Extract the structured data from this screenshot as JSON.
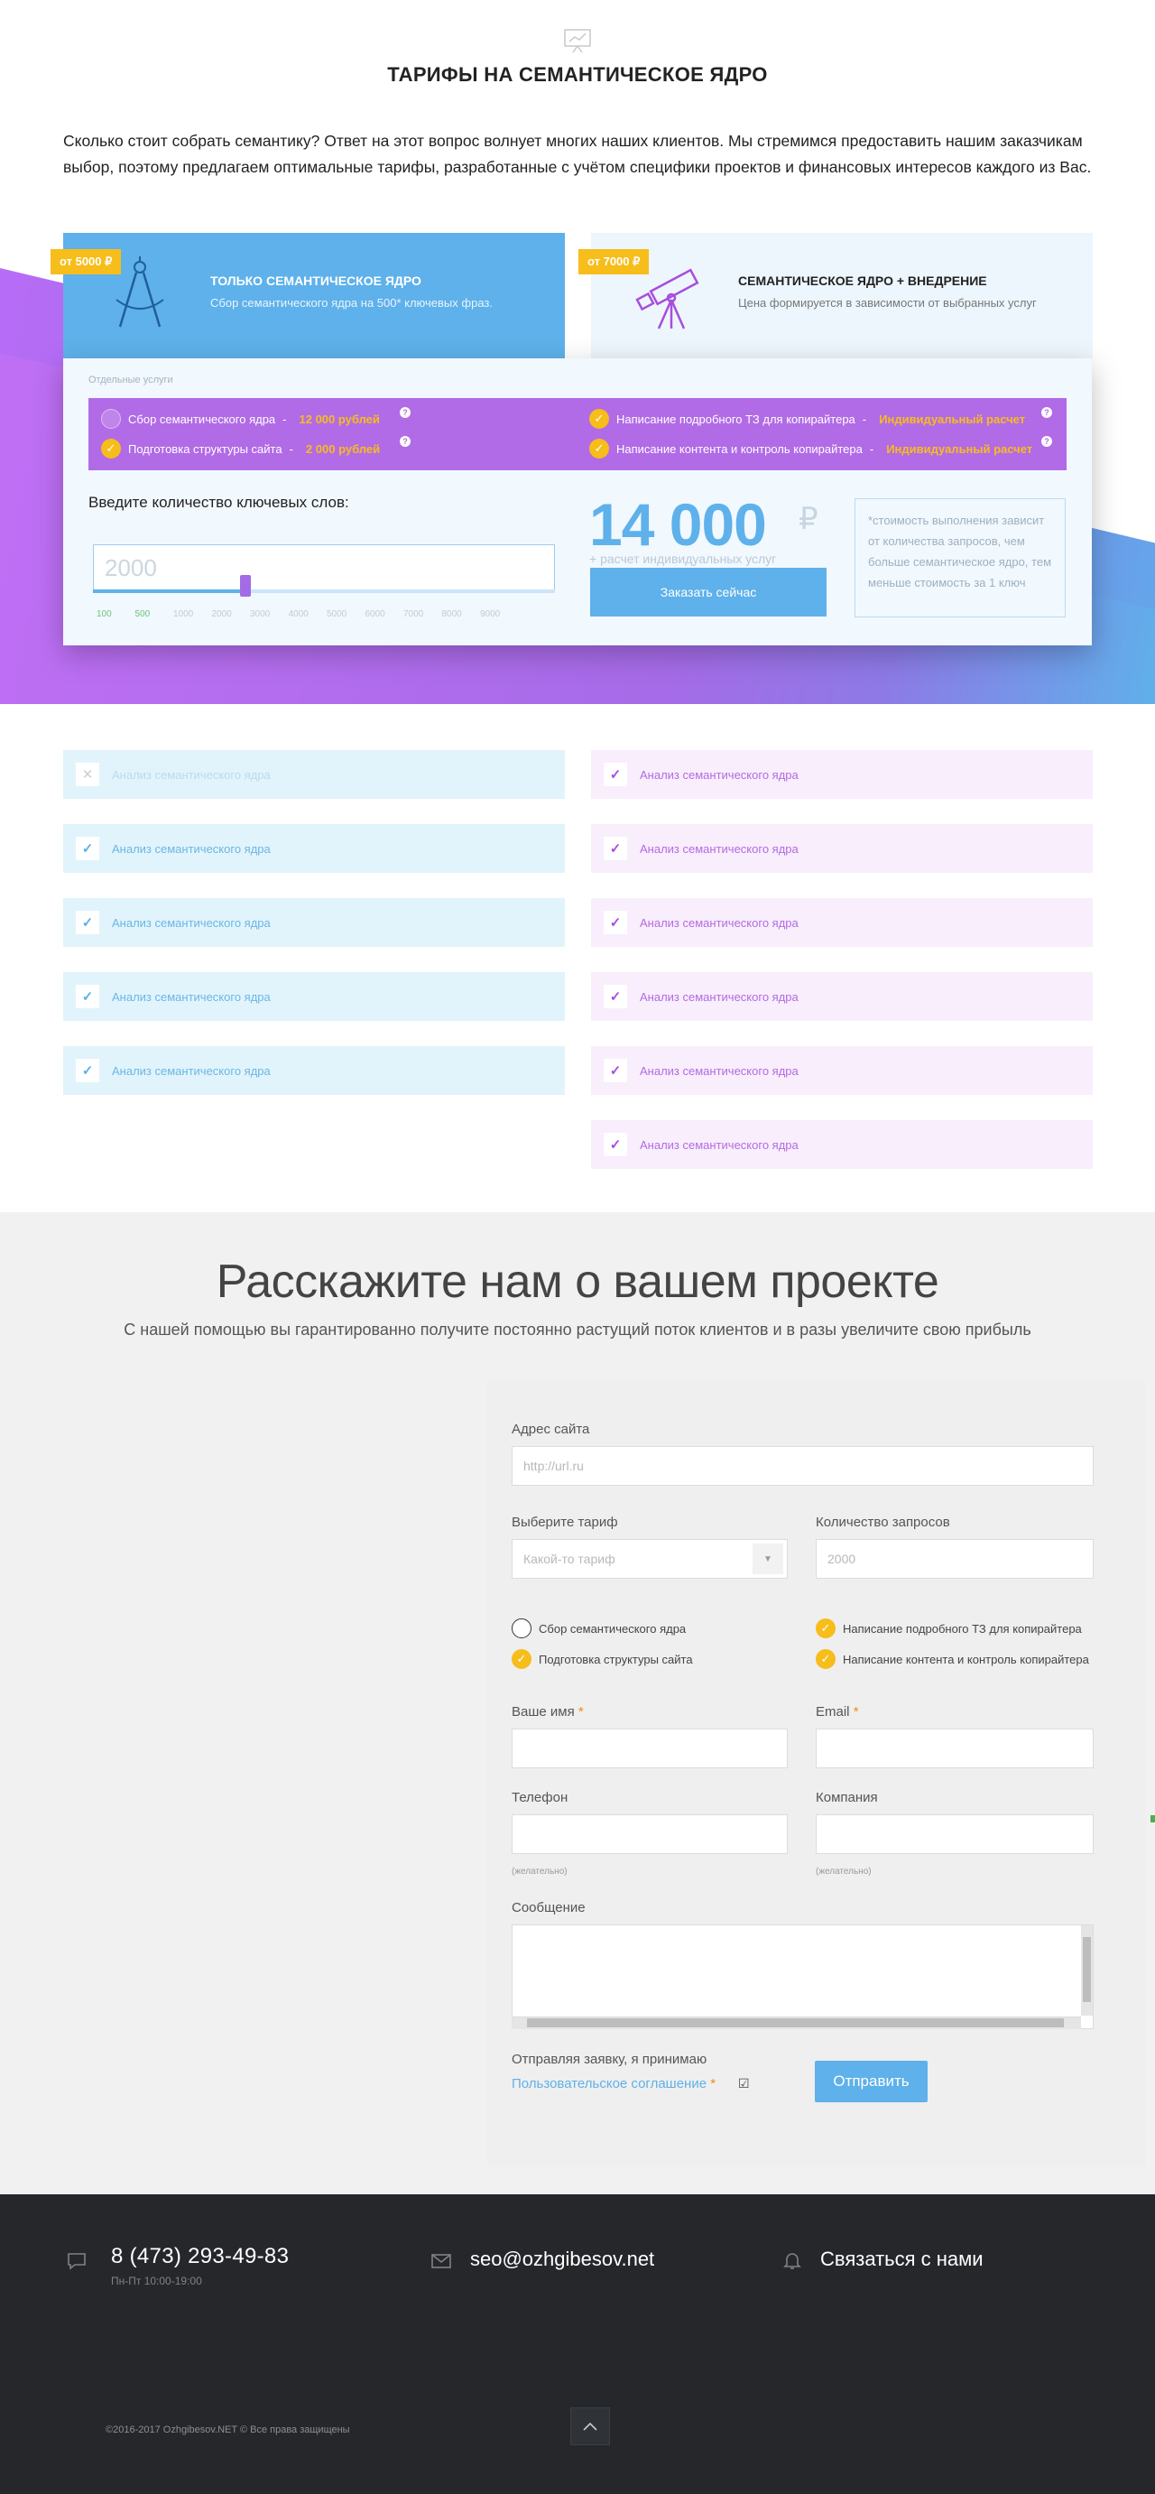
{
  "page": {
    "title": "ТАРИФЫ НА СЕМАНТИЧЕСКОЕ ЯДРО",
    "intro": "Сколько стоит собрать семантику? Ответ на этот вопрос волнует многих наших клиентов. Мы стремимся предоставить нашим заказчикам выбор, поэтому предлагаем оптимальные тарифы, разработанные с учётом специфики проектов и финансовых интересов каждого из Вас."
  },
  "tariffs": [
    {
      "price": "от 5000 ₽",
      "title": "ТОЛЬКО СЕМАНТИЧЕСКОЕ ЯДРО",
      "subtitle": "Сбор семантического ядра на 500* ключевых фраз.",
      "icon": "compass-icon"
    },
    {
      "price": "от 7000 ₽",
      "title": "СЕМАНТИЧЕСКОЕ ЯДРО + ВНЕДРЕНИЕ",
      "subtitle": "Цена формируется в зависимости от выбранных услуг",
      "icon": "telescope-icon"
    }
  ],
  "calculator": {
    "services_caption": "Отдельные услуги",
    "services": [
      {
        "label": "Сбор семантического ядра",
        "price": "12 000 рублей",
        "checked": false
      },
      {
        "label": "Подготовка структуры сайта",
        "price": "2 000 рублей",
        "checked": true
      },
      {
        "label": "Написание подробного ТЗ для копирайтера",
        "price": "Индивидуальный расчет",
        "checked": true
      },
      {
        "label": "Написание контента и контроль копирайтера",
        "price": "Индивидуальный расчет",
        "checked": true
      }
    ],
    "keywords_label": "Введите количество ключевых слов:",
    "keywords_value": "2000",
    "slider_fraction": 0.33,
    "ticks": [
      "100",
      "500",
      "1000",
      "2000",
      "3000",
      "4000",
      "5000",
      "6000",
      "7000",
      "8000",
      "9000"
    ],
    "price": "14 000",
    "currency": "₽",
    "price_note": "+ расчет индивидуальных услуг",
    "order_button": "Заказать сейчас",
    "side_note": "*стоимость выполнения зависит от количества запросов, чем больше семантическое ядро, тем меньше стоимость за 1 ключ"
  },
  "features": {
    "left": [
      {
        "label": "Анализ семантического ядра",
        "included": false
      },
      {
        "label": "Анализ семантического ядра",
        "included": true
      },
      {
        "label": "Анализ семантического ядра",
        "included": true
      },
      {
        "label": "Анализ семантического ядра",
        "included": true
      },
      {
        "label": "Анализ семантического ядра",
        "included": true
      }
    ],
    "right": [
      {
        "label": "Анализ семантического ядра",
        "included": true
      },
      {
        "label": "Анализ семантического ядра",
        "included": true
      },
      {
        "label": "Анализ семантического ядра",
        "included": true
      },
      {
        "label": "Анализ семантического ядра",
        "included": true
      },
      {
        "label": "Анализ семантического ядра",
        "included": true
      },
      {
        "label": "Анализ семантического ядра",
        "included": true
      }
    ]
  },
  "form": {
    "title": "Расскажите нам о вашем проекте",
    "subtitle": "С нашей помощью вы гарантированно получите постоянно растущий поток клиентов и в разы увеличите свою прибыль",
    "site_label": "Адрес сайта",
    "site_placeholder": "http://url.ru",
    "tariff_label": "Выберите тариф",
    "tariff_placeholder": "Какой-то тариф",
    "queries_label": "Количество запросов",
    "queries_placeholder": "2000",
    "services": [
      {
        "label": "Сбор семантического ядра",
        "checked": false
      },
      {
        "label": "Подготовка структуры сайта",
        "checked": true
      },
      {
        "label": "Написание подробного ТЗ для копирайтера",
        "checked": true
      },
      {
        "label": "Написание контента и контроль копирайтера",
        "checked": true
      }
    ],
    "name_label": "Ваше имя",
    "email_label": "Email",
    "required_mark": "*",
    "phone_label": "Телефон",
    "company_label": "Компания",
    "optional_note": "(желательно)",
    "message_label": "Сообщение",
    "agree_text": "Отправляя заявку, я принимаю",
    "agree_link": "Пользовательское соглашение",
    "agree_check": "☑",
    "send_button": "Отправить"
  },
  "footer": {
    "phone": "8 (473) 293-49-83",
    "hours": "Пн-Пт 10:00-19:00",
    "email": "seo@ozhgibesov.net",
    "contact": "Связаться с нами",
    "copyright": "©2016-2017 Ozhgibesov.NET © Все права защищены"
  },
  "colors": {
    "accent_blue": "#5eb1ea",
    "accent_purple": "#b16be6",
    "accent_yellow": "#f7bd1a",
    "footer_bg": "#25272b"
  }
}
